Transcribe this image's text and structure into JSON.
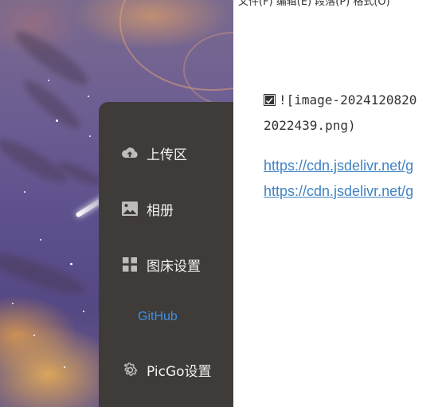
{
  "menubar": {
    "text": "文件(F)   编辑(E)   段落(P)   格式(O)"
  },
  "sidebar": {
    "items": [
      {
        "label": "上传区",
        "icon": "cloud-upload-icon"
      },
      {
        "label": "相册",
        "icon": "image-icon"
      },
      {
        "label": "图床设置",
        "icon": "grid-icon"
      },
      {
        "label": "GitHub",
        "icon": "",
        "sub": true
      },
      {
        "label": "PicGo设置",
        "icon": "gear-icon"
      }
    ]
  },
  "editor": {
    "image_markdown_line1": "![image-2024120820",
    "image_markdown_line2": "2022439.png)",
    "links": [
      "https://cdn.jsdelivr.net/g",
      "https://cdn.jsdelivr.net/g"
    ]
  },
  "colors": {
    "sidebar_bg": "#3f3b39",
    "active_sub": "#3c8fe6",
    "link": "#4183c4"
  }
}
